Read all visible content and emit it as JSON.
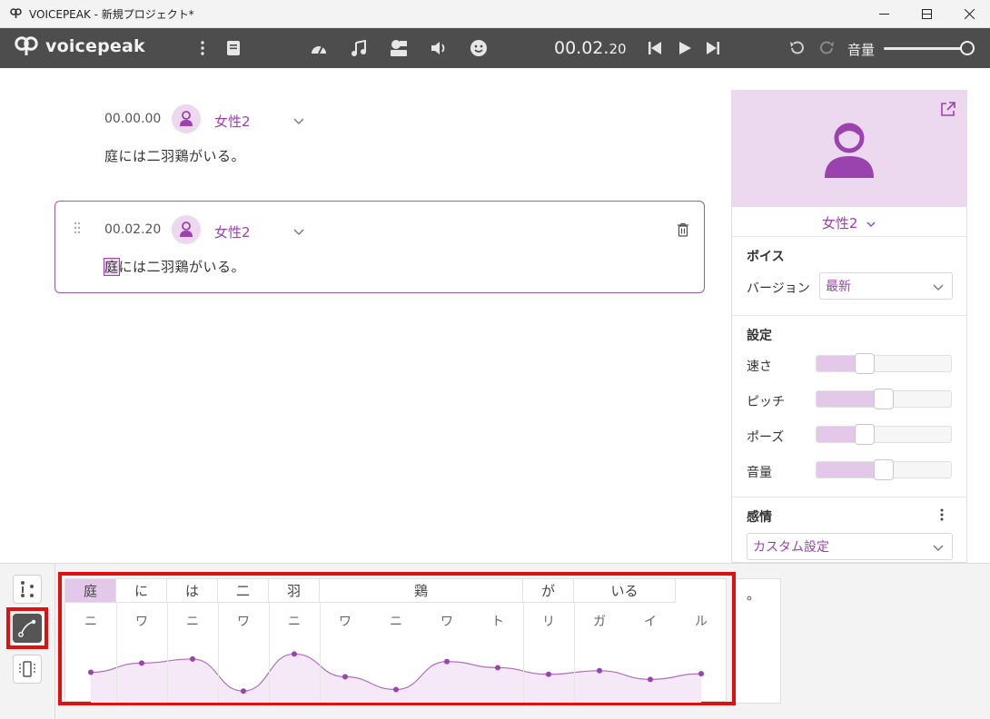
{
  "window": {
    "title": "VOICEPEAK - 新規プロジェクト*"
  },
  "toolbar": {
    "logo": "voicepeak",
    "time_main": "00.02.",
    "time_small": "20",
    "volume_label": "音量",
    "volume_level": 1.0
  },
  "editor": {
    "blocks": [
      {
        "time": "00.00.00",
        "speaker": "女性2",
        "text": "庭には二羽鶏がいる。",
        "selected": false
      },
      {
        "time": "00.02.20",
        "speaker": "女性2",
        "text_highlight": "庭",
        "text_rest": "には二羽鶏がいる。",
        "selected": true
      }
    ]
  },
  "panel": {
    "voice_name": "女性2",
    "voice_section": "ボイス",
    "version_label": "バージョン",
    "version_value": "最新",
    "settings_section": "設定",
    "sliders": [
      {
        "label": "速さ",
        "value": 0.36
      },
      {
        "label": "ピッチ",
        "value": 0.5
      },
      {
        "label": "ポーズ",
        "value": 0.36
      },
      {
        "label": "音量",
        "value": 0.5
      }
    ],
    "emotion_section": "感情",
    "emotion_value": "カスタム設定"
  },
  "tuner": {
    "kanji_cells": [
      "庭",
      "に",
      "は",
      "二",
      "羽",
      "鶏",
      "が",
      "いる"
    ],
    "kana": [
      "ニ",
      "ワ",
      "ニ",
      "ワ",
      "ニ",
      "ワ",
      "ニ",
      "ワ",
      "ト",
      "リ",
      "ガ",
      "イ",
      "ル"
    ],
    "period": "。",
    "pitch_points": [
      0.42,
      0.6,
      0.68,
      0.05,
      0.78,
      0.33,
      0.08,
      0.63,
      0.51,
      0.38,
      0.45,
      0.28,
      0.39
    ]
  },
  "colors": {
    "accent": "#9a42ad",
    "accent_light": "#ecd8ef",
    "toolbar": "#4d4d4d",
    "highlight": "#e01010"
  }
}
